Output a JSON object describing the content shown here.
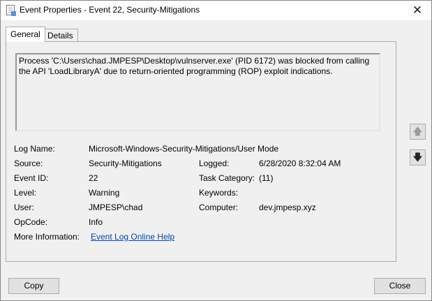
{
  "window": {
    "title": "Event Properties - Event 22, Security-Mitigations",
    "close_glyph": "✕"
  },
  "tabs": [
    {
      "label": "General",
      "active": true
    },
    {
      "label": "Details",
      "active": false
    }
  ],
  "description": "Process 'C:\\Users\\chad.JMPESP\\Desktop\\vulnserver.exe' (PID 6172) was blocked from calling the API 'LoadLibraryA' due to return-oriented programming (ROP) exploit indications.",
  "fields": {
    "log_name": {
      "label": "Log Name:",
      "value": "Microsoft-Windows-Security-Mitigations/User Mode"
    },
    "source": {
      "label": "Source:",
      "value": "Security-Mitigations"
    },
    "logged": {
      "label": "Logged:",
      "value": "6/28/2020 8:32:04 AM"
    },
    "event_id": {
      "label": "Event ID:",
      "value": "22"
    },
    "task_category": {
      "label": "Task Category:",
      "value": "(11)"
    },
    "level": {
      "label": "Level:",
      "value": "Warning"
    },
    "keywords": {
      "label": "Keywords:",
      "value": ""
    },
    "user": {
      "label": "User:",
      "value": "JMPESP\\chad"
    },
    "computer": {
      "label": "Computer:",
      "value": "dev.jmpesp.xyz"
    },
    "opcode": {
      "label": "OpCode:",
      "value": "Info"
    },
    "more_info": {
      "label": "More Information:",
      "value": "Event Log Online Help"
    }
  },
  "nav": {
    "up_icon": "arrow-up-icon",
    "down_icon": "arrow-down-icon"
  },
  "buttons": {
    "copy": "Copy",
    "close": "Close"
  }
}
